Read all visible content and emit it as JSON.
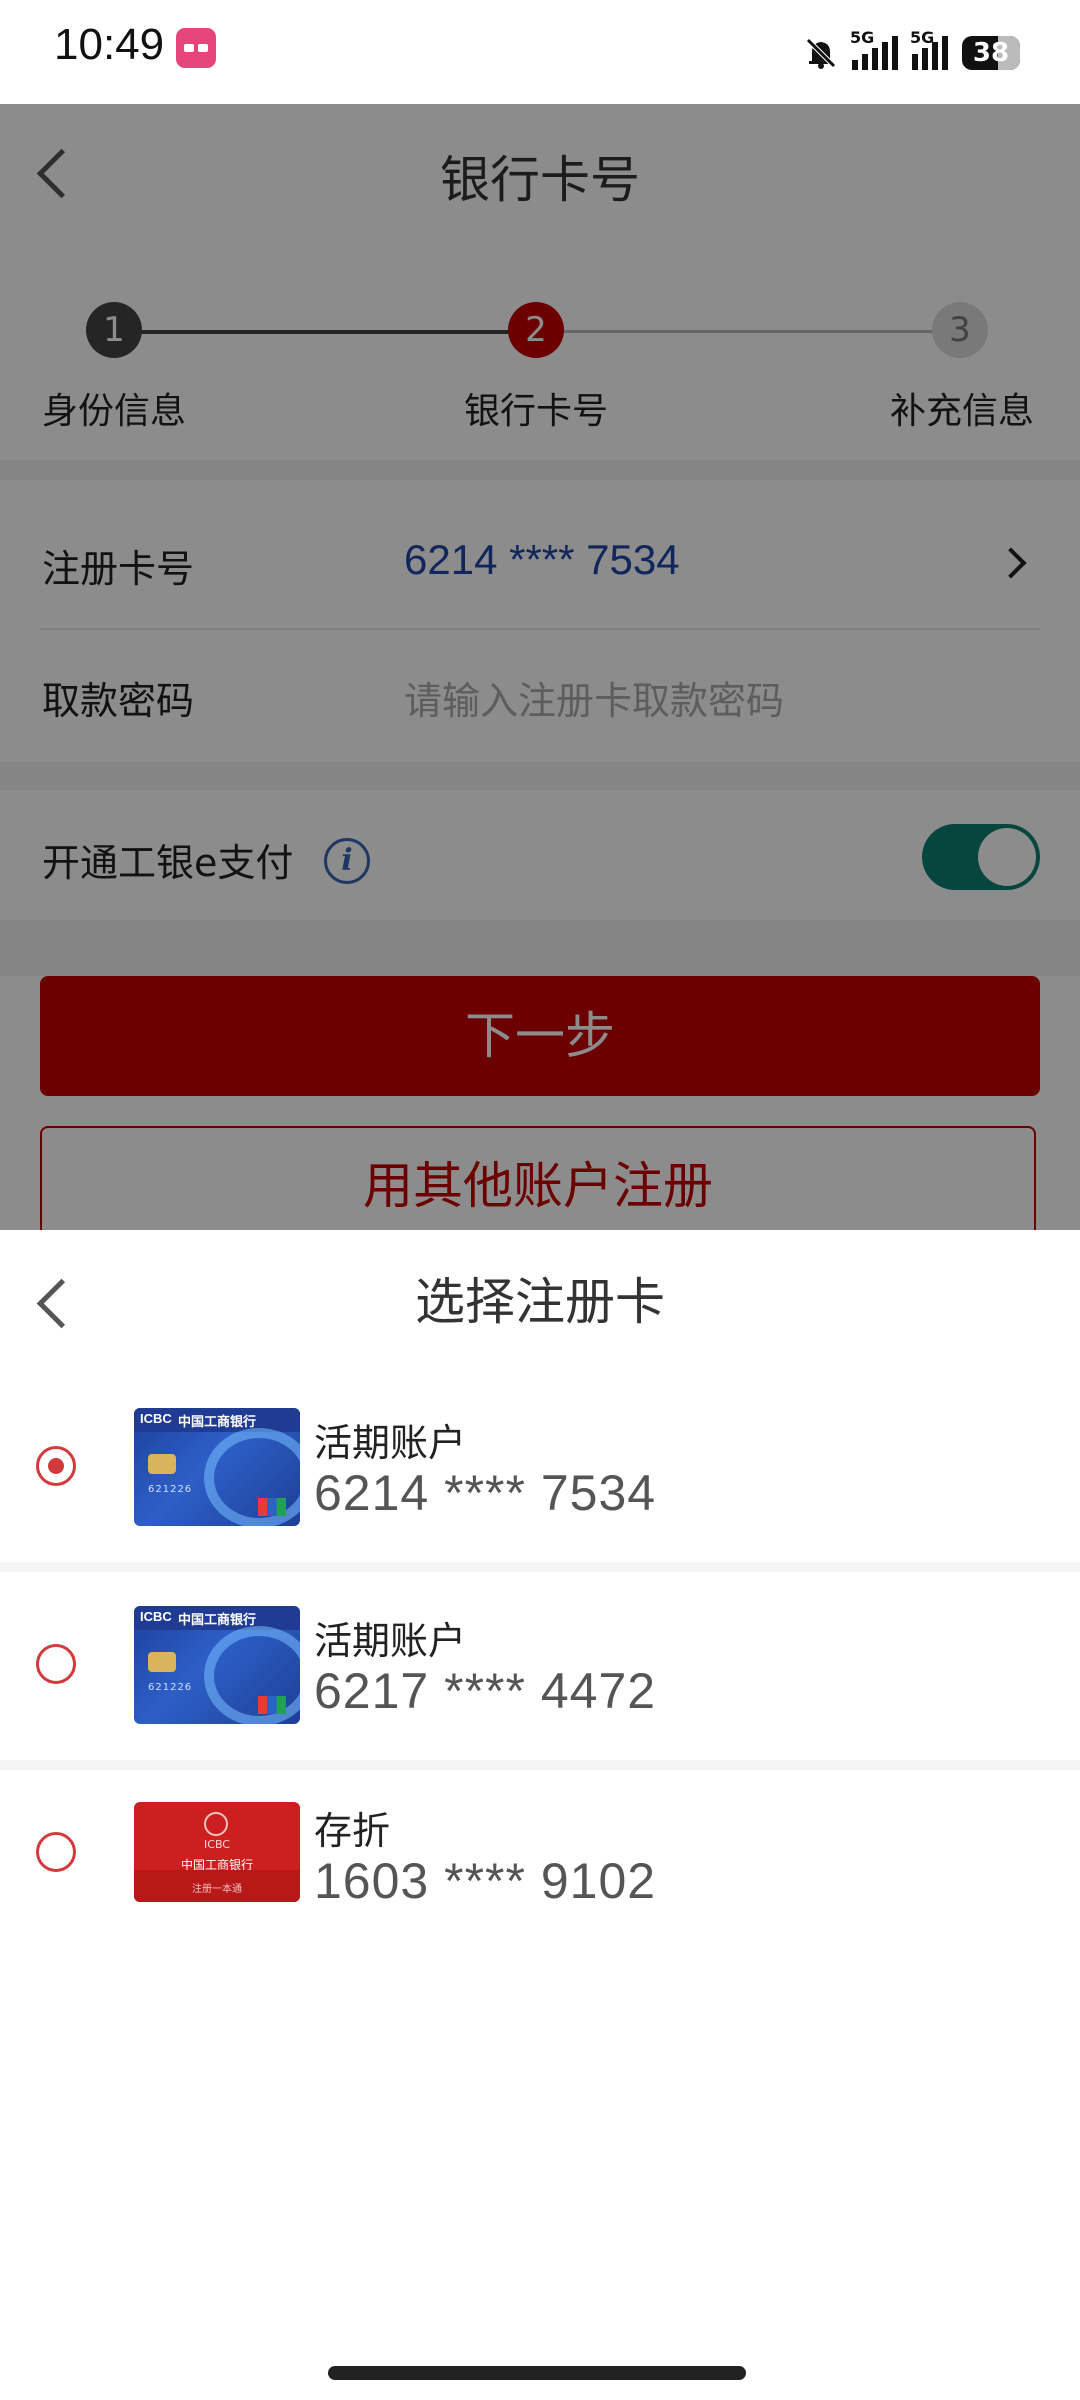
{
  "status": {
    "time": "10:49",
    "net1": "5G",
    "net2": "5G",
    "battery": "38"
  },
  "page": {
    "title": "银行卡号",
    "steps": [
      {
        "num": "1",
        "label": "身份信息"
      },
      {
        "num": "2",
        "label": "银行卡号"
      },
      {
        "num": "3",
        "label": "补充信息"
      }
    ],
    "card_label": "注册卡号",
    "card_value": "6214 **** 7534",
    "pwd_label": "取款密码",
    "pwd_placeholder": "请输入注册卡取款密码",
    "epay_label": "开通工银e支付",
    "info_icon": "i",
    "epay_enabled": true,
    "next_button": "下一步",
    "other_button": "用其他账户注册",
    "colors": {
      "primary": "#c50000",
      "toggle": "#0d7f73",
      "link": "#1f46a8"
    }
  },
  "sheet": {
    "title": "选择注册卡",
    "cards": [
      {
        "type": "活期账户",
        "number": "6214 **** 7534",
        "selected": true,
        "img": "icbc-debit-card"
      },
      {
        "type": "活期账户",
        "number": "6217 **** 4472",
        "selected": false,
        "img": "icbc-debit-card"
      },
      {
        "type": "存折",
        "number": "1603 **** 9102",
        "selected": false,
        "img": "icbc-passbook"
      }
    ]
  },
  "card_art": {
    "brand": "ICBC",
    "bank_name": "中国工商银行",
    "card_digits": "621226",
    "passbook_footer": "注册一本通"
  }
}
